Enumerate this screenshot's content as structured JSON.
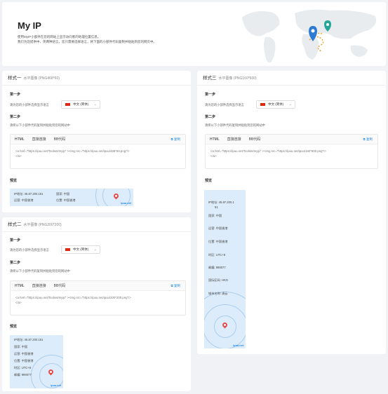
{
  "hero": {
    "title": "My IP",
    "desc_line1": "使用MyIP小部件在您的网站上显示访问者的地理位置信息。",
    "desc_line2": "我们为您提供中、英两种语言，您只需要选择语言，将下面的小部件代码复制并粘贴到您的网页中。"
  },
  "card1": {
    "title": "样式一",
    "subtitle": "水平图像 (PNG468*60)",
    "step1": "第一步",
    "step1_hint": "请为您的小部件选择显示语言",
    "lang": "中文 (简体)",
    "step2": "第二步",
    "step2_hint": "请将以下小部件代码复制并粘贴到您的网站中",
    "tabs": [
      "HTML",
      "直接连接",
      "BB代码"
    ],
    "copy": "复制",
    "code_line1": "<a href=\"https://ipuu.net/Toolset/myip\" ><img src=\"https://ipuu.net/ipuu/468*60.png\"/>",
    "code_line2": "</a>",
    "preview": "预览",
    "widget": {
      "ip_label": "IP地址:",
      "ip": "45.87.200.151",
      "country_label": "国家:",
      "country": "中国",
      "isp_label": "运营:",
      "isp": "中国香港",
      "loc_label": "位置:",
      "loc": "中国香港",
      "brand": "ipuu.net"
    }
  },
  "card2": {
    "title": "样式二",
    "subtitle": "水平图像 (PNG200*200)",
    "step1": "第一步",
    "step1_hint": "请为您的小部件选择显示语言",
    "lang": "中文 (简体)",
    "step2": "第二步",
    "step2_hint": "请将以下小部件代码复制并粘贴到您的网站中",
    "tabs": [
      "HTML",
      "直接连接",
      "BB代码"
    ],
    "copy": "复制",
    "code_line1": "<a href=\"https://ipuu.net/Toolset/myip\" ><img src=\"https://ipuu.net/ipuu/200*200.png\"/>",
    "code_line2": "</a>",
    "preview": "预览",
    "widget": {
      "rows": [
        "IP地址:  45.87.200.151",
        "国家:     中国",
        "运营:     中国香港",
        "位置:     中国香港",
        "时区:     UTC+8",
        "邮编:     999077"
      ],
      "brand": "ipuu.net"
    }
  },
  "card3": {
    "title": "样式三",
    "subtitle": "水平图像 (PNG160*600)",
    "step1": "第一步",
    "step1_hint": "请为您的小部件选择显示语言",
    "lang": "中文 (简体)",
    "step2": "第二步",
    "step2_hint": "请将以下小部件代码复制并粘贴到您的网站中",
    "tabs": [
      "HTML",
      "直接连接",
      "BB代码"
    ],
    "copy": "复制",
    "code_line1": "<a href=\"https://ipuu.net/Toolset/myip\" ><img src=\"https://ipuu.net/ipuu/160*600.png\"/>",
    "code_line2": "</a>",
    "preview": "预览",
    "widget": {
      "rows": [
        "IP地址:  45.87.200.1",
        "51",
        "国家:     中国",
        "运营:     中国香港",
        "位置:     中国香港",
        "时区:     UTC+8",
        "邮编:     999077",
        "国际区码:  HKG",
        "城市名称:  清云"
      ],
      "brand": "ipuu.net"
    }
  },
  "colors": {
    "accent": "#1e88e5",
    "pin": "#e84a4a",
    "pin2": "#26a69a",
    "widget_bg": "#dcecfa"
  }
}
